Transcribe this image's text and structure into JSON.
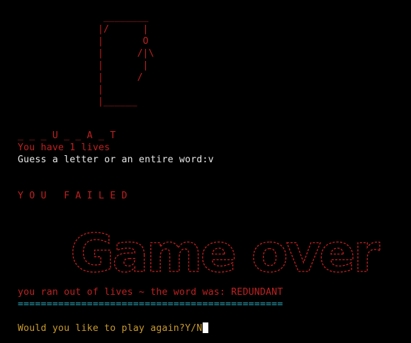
{
  "colors": {
    "background": "#000000",
    "red": "#c02020",
    "white": "#e6e6e6",
    "cyan": "#2aa6b8",
    "yellow": "#c89a2a"
  },
  "gallows_art": " ________\n|/      |\n|       O\n|      /|\\\n|       |\n|      /\n|\n|______",
  "word_progress": "_ _ _ U _ _ A _ T",
  "lives_message": "You have 1 lives",
  "guess_prompt": "Guess a letter or an entire word:v",
  "fail_banner": "Y O U   F A I L E D",
  "game_over_art_text": "Game over",
  "ran_out_message": "you ran out of lives ~ the word was: REDUNDANT",
  "divider": "==============================================",
  "play_again_prompt": "Would you like to play again?Y/N"
}
